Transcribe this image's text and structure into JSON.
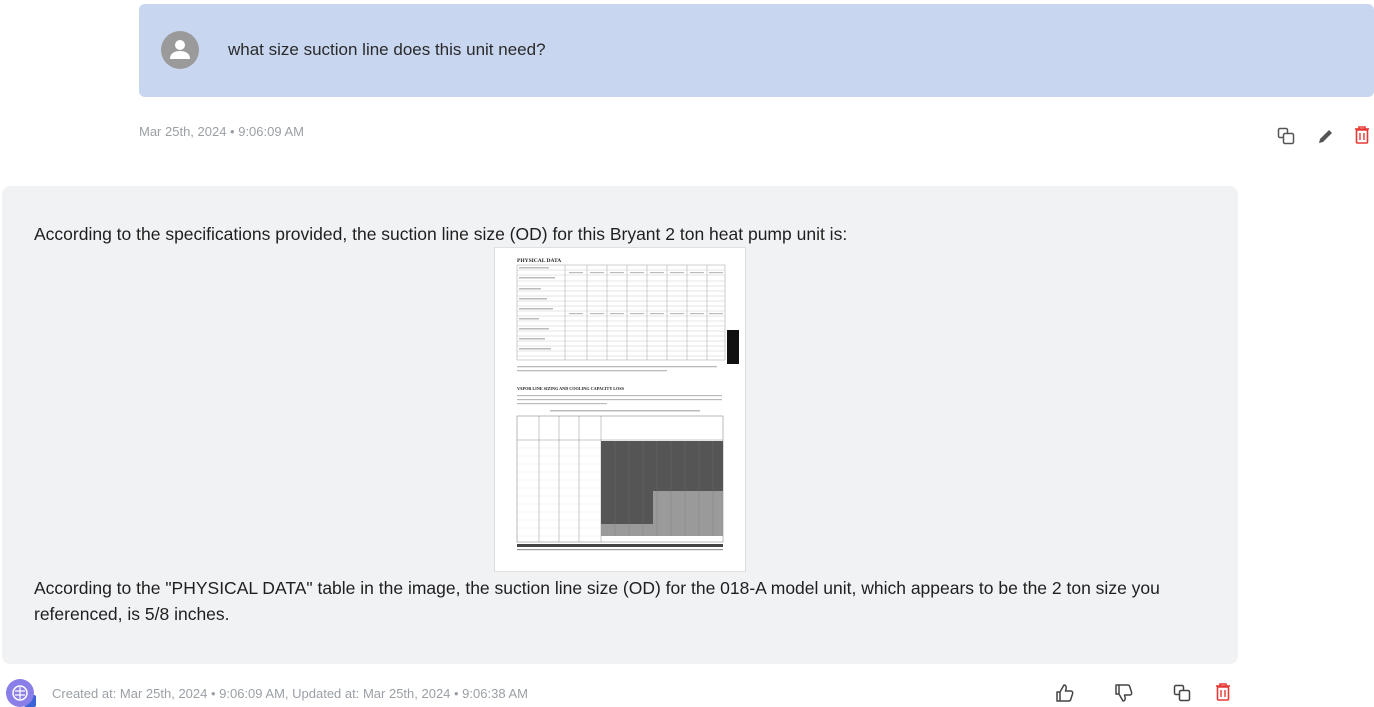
{
  "user_message": {
    "text": "what size suction line does this unit need?",
    "timestamp": "Mar 25th, 2024 • 9:06:09 AM"
  },
  "user_actions": {
    "copy_icon": "copy-icon",
    "edit_icon": "pencil-icon",
    "delete_icon": "trash-icon"
  },
  "ai_message": {
    "intro": "According to the specifications provided, the suction line size (OD) for this Bryant 2 ton heat pump unit is:",
    "answer": "According to the \"PHYSICAL DATA\" table in the image, the suction line size (OD) for the 018-A model unit, which appears to be the 2 ton size you referenced, is 5/8 inches.",
    "meta": "Created at: Mar 25th, 2024 • 9:06:09 AM, Updated at: Mar 25th, 2024 • 9:06:38 AM",
    "doc_image": {
      "heading1": "PHYSICAL DATA",
      "heading2": "VAPOR LINE SIZING AND COOLING CAPACITY LOSS"
    }
  },
  "ai_actions": {
    "like_icon": "thumbs-up-icon",
    "dislike_icon": "thumbs-down-icon",
    "copy_icon": "copy-icon",
    "delete_icon": "trash-icon"
  },
  "colors": {
    "user_bubble": "#c8d6f0",
    "ai_bubble": "#f1f2f4",
    "delete": "#e53935",
    "bot_avatar": "#8a7ee8"
  }
}
